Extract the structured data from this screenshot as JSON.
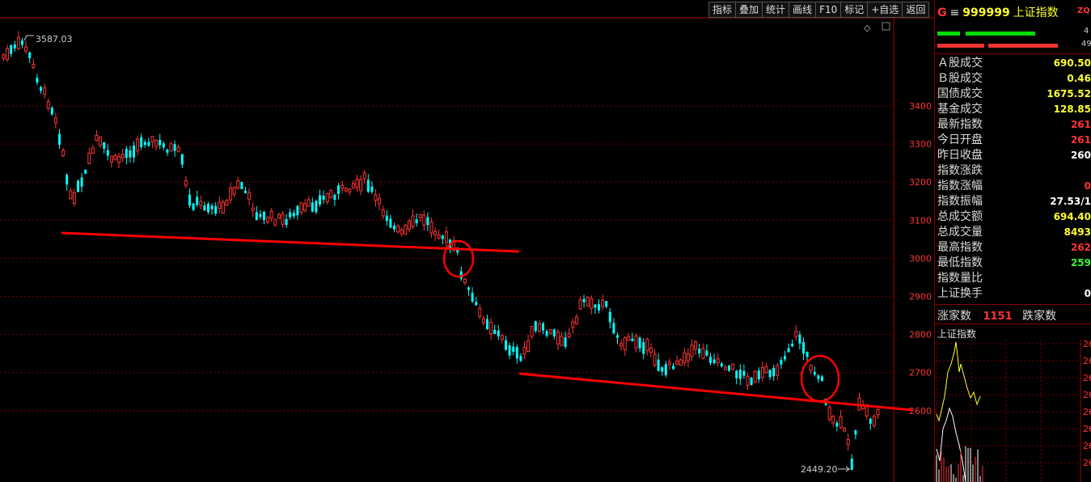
{
  "toolbar": [
    "指标",
    "叠加",
    "统计",
    "画线",
    "F10",
    "标记",
    "+自选",
    "返回"
  ],
  "chart": {
    "y_ticks": [
      "3400",
      "3300",
      "3200",
      "3100",
      "3000",
      "2900",
      "2800",
      "2700",
      "2600"
    ],
    "high_label": "3587.03",
    "low_label": "2449.20",
    "colors": {
      "up": "#ff3333",
      "down": "#00ffff",
      "grid": "#7a0000",
      "trendline": "#ff0000"
    }
  },
  "panel": {
    "g": "G",
    "menu": "≡",
    "code": "999999",
    "name": "上证指数",
    "zq": "ZQ",
    "bar_top_right": "4",
    "bar_bottom_right": "49",
    "rows": [
      {
        "label": "Ａ股成交",
        "value": "690.50",
        "color": "#ffff33"
      },
      {
        "label": "Ｂ股成交",
        "value": "0.46",
        "color": "#ffff33"
      },
      {
        "label": "国债成交",
        "value": "1675.52",
        "color": "#ffff33"
      },
      {
        "label": "基金成交",
        "value": "128.85",
        "color": "#ffff33"
      },
      {
        "label": "最新指数",
        "value": "261",
        "color": "#ff3333"
      },
      {
        "label": "今日开盘",
        "value": "261",
        "color": "#ff3333"
      },
      {
        "label": "昨日收盘",
        "value": "260",
        "color": "#ffffff"
      },
      {
        "label": "指数涨跌",
        "value": "",
        "color": "#ff3333"
      },
      {
        "label": "指数涨幅",
        "value": "0",
        "color": "#ff3333"
      },
      {
        "label": "指数振幅",
        "value": "27.53/1",
        "color": "#ffffff"
      },
      {
        "label": "总成交额",
        "value": "694.40",
        "color": "#ffff33"
      },
      {
        "label": "总成交量",
        "value": "8493",
        "color": "#ffff33"
      },
      {
        "label": "最高指数",
        "value": "262",
        "color": "#ff3333"
      },
      {
        "label": "最低指数",
        "value": "259",
        "color": "#33ff33"
      },
      {
        "label": "指数量比",
        "value": "",
        "color": "#ffffff"
      },
      {
        "label": "上证换手",
        "value": "0",
        "color": "#ffffff"
      }
    ],
    "up_label": "涨家数",
    "up_count": "1151",
    "down_label": "跌家数",
    "mini_title": "上证指数",
    "mini_ticks": [
      "26",
      "26",
      "26",
      "26",
      "26",
      "26",
      "26",
      "26"
    ]
  }
}
